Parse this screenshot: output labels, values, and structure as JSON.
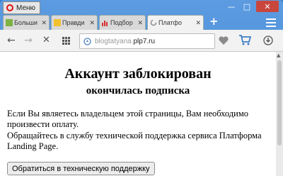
{
  "window": {
    "menu_label": "Меню",
    "minimize": "—",
    "maximize": "□",
    "close": "✕"
  },
  "tabs": [
    {
      "title": "Больши",
      "favicon": "green-square-icon",
      "active": false
    },
    {
      "title": "Правди",
      "favicon": "yellow-square-icon",
      "active": false
    },
    {
      "title": "Подбор",
      "favicon": "bar-chart-icon",
      "active": false
    },
    {
      "title": "Платфо",
      "favicon": "loading-spinner-icon",
      "active": true
    }
  ],
  "toolbar": {
    "url_prefix": "blogtatyana.",
    "url_domain": "plp7.ru"
  },
  "page": {
    "heading": "Аккаунт заблокирован",
    "subheading": "окончилась подписка",
    "paragraph1": "Если Вы являетесь владельцем этой страницы, Вам необходимо произвести оплату.",
    "paragraph2": "Обращайтесь в службу технической поддержка сервиса Платформа Landing Page.",
    "button": "Обратиться в техническую поддержку"
  }
}
